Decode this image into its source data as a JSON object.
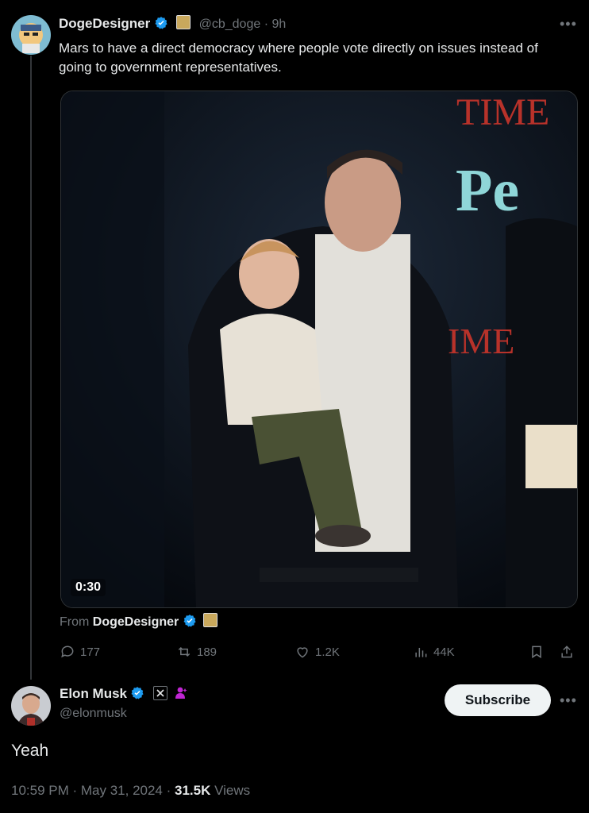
{
  "quoted": {
    "display_name": "DogeDesigner",
    "handle": "@cb_doge",
    "separator": "·",
    "time_ago": "9h",
    "text": "Mars to have a direct democracy where people vote directly on issues instead of going to government representatives.",
    "media": {
      "duration": "0:30",
      "sign_top": "TIME",
      "sign_big": "Pe",
      "sign_mid": "IME"
    },
    "from_label": "From",
    "from_name": "DogeDesigner",
    "actions": {
      "replies": "177",
      "reposts": "189",
      "likes": "1.2K",
      "views": "44K"
    }
  },
  "main": {
    "display_name": "Elon Musk",
    "handle": "@elonmusk",
    "subscribe_label": "Subscribe",
    "text": "Yeah",
    "timestamp": "10:59 PM · May 31, 2024 ·",
    "views_count": "31.5K",
    "views_label": "Views"
  },
  "colors": {
    "background": "#000000",
    "text": "#e7e9ea",
    "muted": "#71767b",
    "verified": "#1d9bf0",
    "affiliate_badge": "#c026d3"
  },
  "icons": [
    "more-icon",
    "verified-icon",
    "affiliate-doge-icon",
    "reply-icon",
    "repost-icon",
    "like-icon",
    "views-icon",
    "bookmark-icon",
    "share-icon",
    "x-affiliate-icon",
    "purple-person-icon"
  ]
}
